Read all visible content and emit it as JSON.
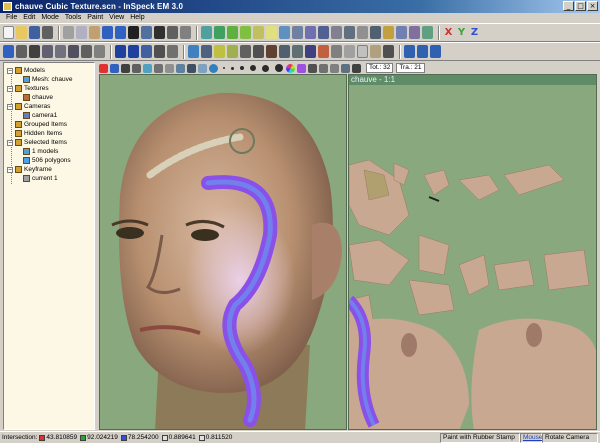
{
  "window": {
    "title": "chauve Cubic Texture.scn - InSpeck EM 3.0",
    "controls": [
      "_",
      "□",
      "×"
    ]
  },
  "menu": [
    "File",
    "Edit",
    "Mode",
    "Tools",
    "Paint",
    "View",
    "Help"
  ],
  "toolbar_axes": [
    "X",
    "Y",
    "Z"
  ],
  "tree": {
    "items": [
      {
        "label": "Models",
        "level": 0,
        "exp": "−"
      },
      {
        "label": "Mesh: chauve",
        "level": 1,
        "exp": ""
      },
      {
        "label": "Textures",
        "level": 0,
        "exp": "−"
      },
      {
        "label": "chauve",
        "level": 1,
        "exp": ""
      },
      {
        "label": "Cameras",
        "level": 0,
        "exp": "−"
      },
      {
        "label": "camera1",
        "level": 1,
        "exp": ""
      },
      {
        "label": "Grouped Items",
        "level": 0,
        "exp": ""
      },
      {
        "label": "Hidden Items",
        "level": 0,
        "exp": ""
      },
      {
        "label": "Selected Items",
        "level": 0,
        "exp": "−"
      },
      {
        "label": "1 models",
        "level": 1,
        "exp": ""
      },
      {
        "label": "506 polygons",
        "level": 1,
        "exp": ""
      },
      {
        "label": "Keyframe",
        "level": 0,
        "exp": "−"
      },
      {
        "label": "current 1",
        "level": 1,
        "exp": ""
      }
    ]
  },
  "paintbar": {
    "tot_label": "Tot.: 32",
    "tra_label": "Tra.: 21"
  },
  "uv_view": {
    "title": "chauve - 1:1"
  },
  "status": {
    "intersection_label": "Intersection:",
    "fields": [
      {
        "value": "43.810859",
        "color": "#e03030"
      },
      {
        "value": "92.024219",
        "color": "#30a030"
      },
      {
        "value": "78.254200",
        "color": "#3050e0"
      },
      {
        "value": "0.889641",
        "color": "#e0e0e0"
      },
      {
        "value": "0.811520",
        "color": "#e0e0e0"
      }
    ],
    "paint_mode": "Paint with Rubber Stamp",
    "mouse_label": "Mouse",
    "camera_mode": "Rotate Camera"
  },
  "colors": {
    "viewport_bg": "#8aa87e",
    "title_bar": "#0a246a",
    "tree_bg": "#fdf8e6",
    "brush_stroke": "#8a50e8"
  }
}
